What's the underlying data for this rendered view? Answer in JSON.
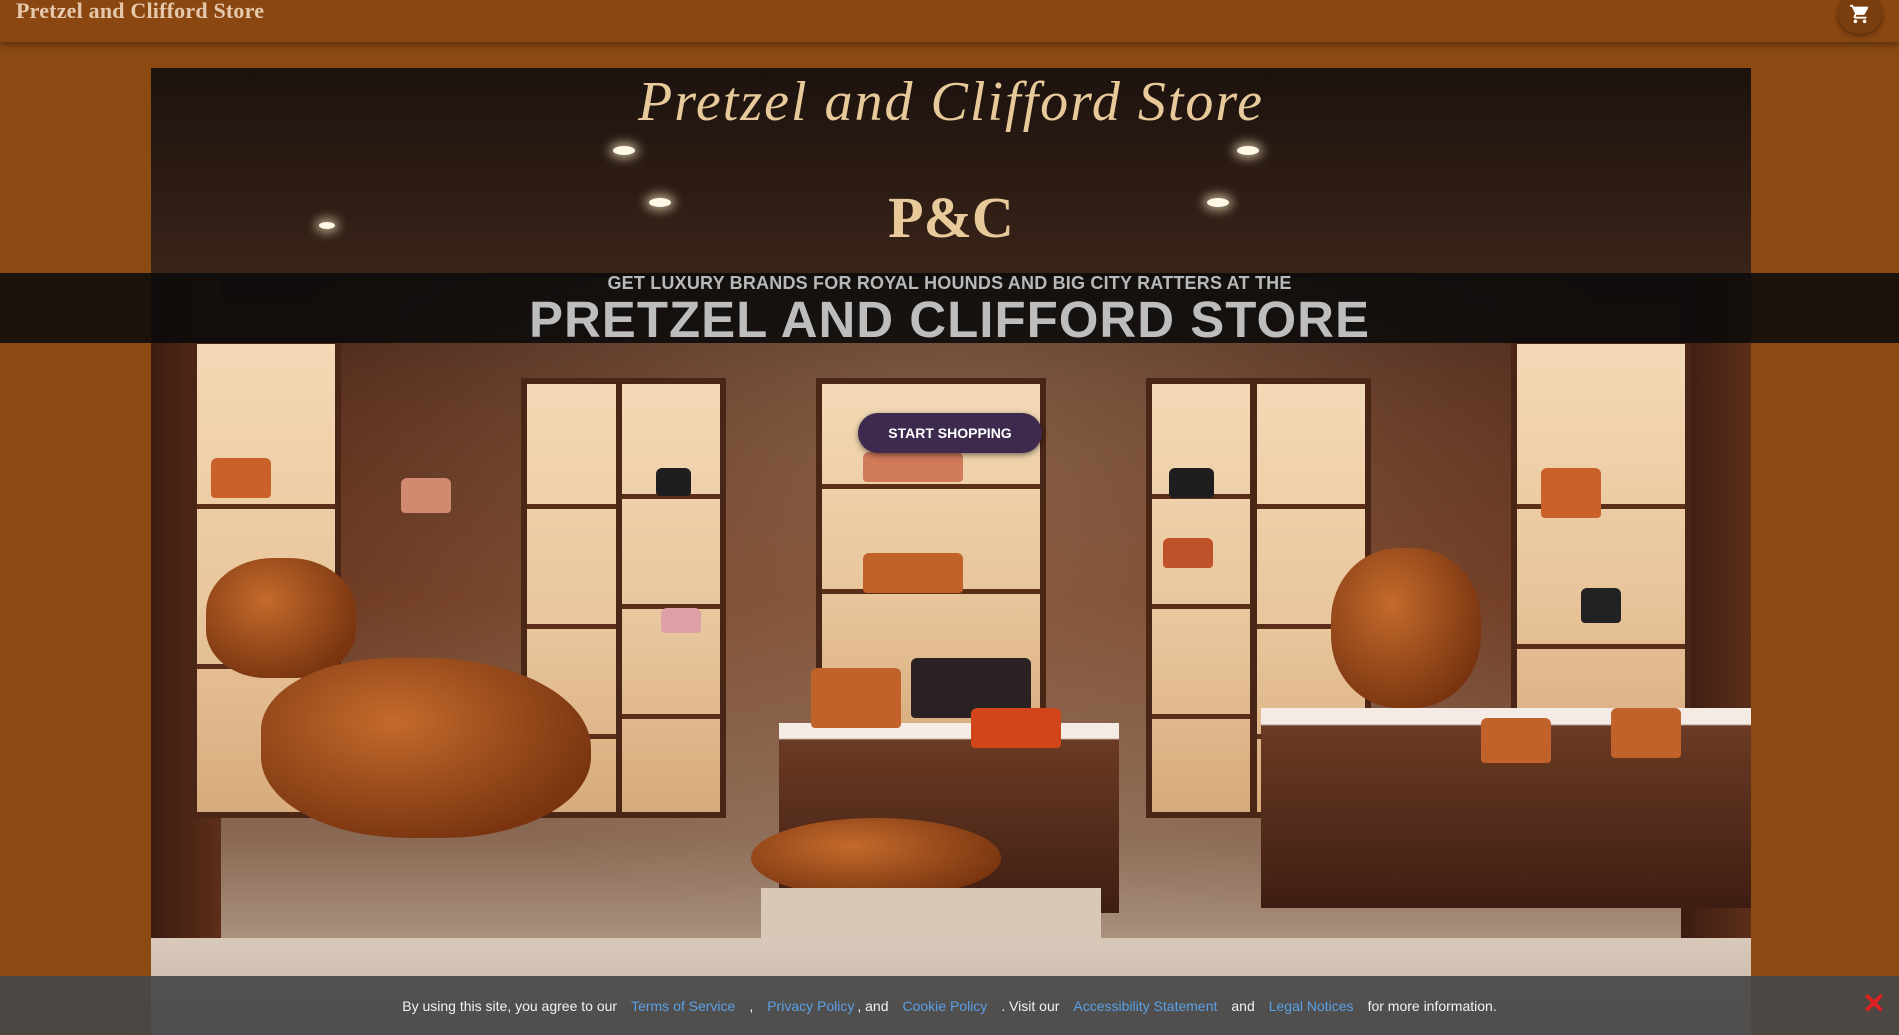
{
  "header": {
    "brand": "Pretzel and Clifford Store",
    "cart_icon": "shopping-cart-icon"
  },
  "hero": {
    "sign_text": "Pretzel and Clifford Store",
    "monogram": "P&C",
    "tagline": "GET LUXURY BRANDS FOR ROYAL HOUNDS AND BIG CITY RATTERS AT THE",
    "headline": "PRETZEL AND CLIFFORD STORE",
    "cta_label": "START SHOPPING"
  },
  "cookie_notice": {
    "part1": "By using this site, you agree to our",
    "terms": "Terms of Service",
    "comma": ",",
    "privacy": "Privacy Policy",
    "and1": ", and",
    "cookie": "Cookie Policy",
    "visit": ". Visit our",
    "accessibility": "Accessibility Statement",
    "and2": "and",
    "legal": "Legal Notices",
    "end": "for more information.",
    "close_icon": "close-x-icon"
  },
  "colors": {
    "page_bg": "#8a4a12",
    "cta_bg": "#3d2a4e",
    "link": "#5aa0e6",
    "close": "#e02020"
  }
}
